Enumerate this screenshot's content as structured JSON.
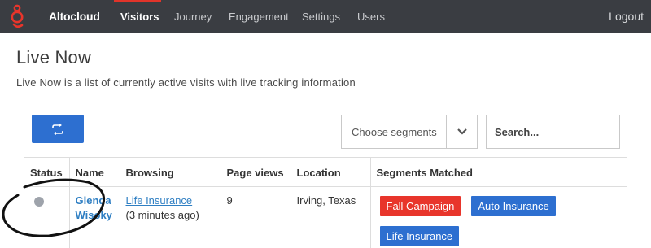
{
  "nav": {
    "brand": "Altocloud",
    "items": [
      {
        "label": "Visitors",
        "active": true
      },
      {
        "label": "Journey",
        "active": false
      },
      {
        "label": "Engagement",
        "active": false
      },
      {
        "label": "Settings",
        "active": false
      },
      {
        "label": "Users",
        "active": false
      }
    ],
    "logout": "Logout"
  },
  "header": {
    "title": "Live Now",
    "description": "Live Now is a list of currently active visits with live tracking information"
  },
  "toolbar": {
    "refresh_icon": "refresh-icon",
    "segments_label": "Choose segments",
    "search_placeholder": "Search..."
  },
  "table": {
    "columns": [
      "Status",
      "Name",
      "Browsing",
      "Page views",
      "Location",
      "Segments Matched"
    ],
    "rows": [
      {
        "status": "inactive",
        "name_line1": "Glenda",
        "name_line2": "Wisoky",
        "browsing_link": "Life Insurance",
        "browsing_time": "(3 minutes ago)",
        "page_views": "9",
        "location": "Irving, Texas",
        "segments": [
          {
            "label": "Fall Campaign",
            "color": "#e8352b"
          },
          {
            "label": "Auto Insurance",
            "color": "#2d6fd0"
          },
          {
            "label": "Life Insurance",
            "color": "#2d6fd0"
          }
        ]
      }
    ]
  },
  "colors": {
    "nav_bg": "#3a3d42",
    "accent_red": "#e0342a",
    "primary_blue": "#2d6fd0",
    "link_blue": "#2f7fc3",
    "status_inactive": "#9ea3ab"
  }
}
